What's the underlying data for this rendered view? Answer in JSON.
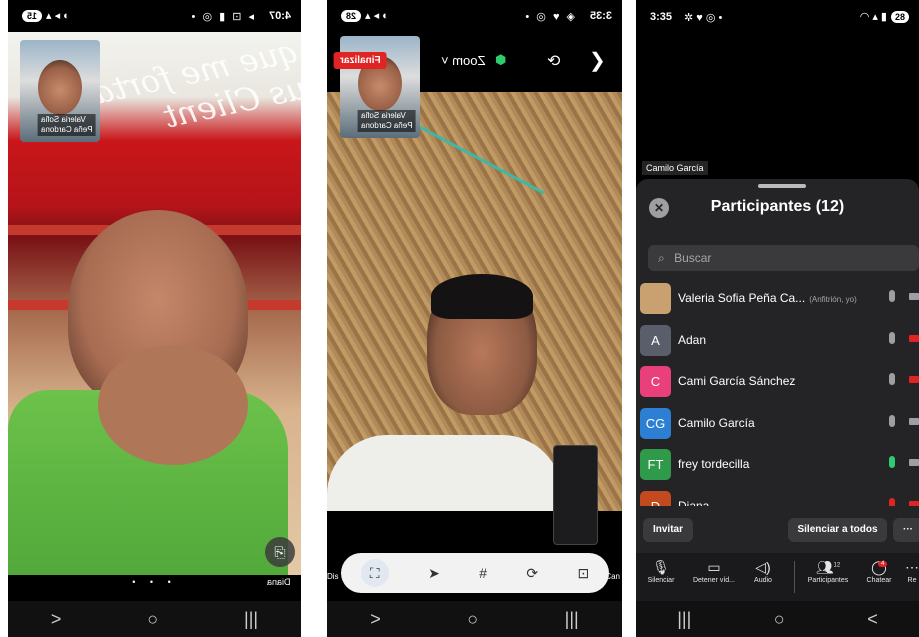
{
  "phone1": {
    "status": {
      "time": "4:07",
      "badge": "15"
    },
    "pip": {
      "name_line1": "Valeria Sofia",
      "name_line2": "Peña Cardona"
    },
    "store_text": "que me fortal us Client",
    "caption_name": "Diana"
  },
  "phone2": {
    "status": {
      "time": "3:35",
      "badge": "28"
    },
    "end_button": "Finalizar",
    "app_title": "Zoom",
    "pip": {
      "name_line1": "Valeria Sofia",
      "name_line2": "Peña Cardona"
    },
    "side_left": "Dis",
    "side_right": "Can"
  },
  "phone3": {
    "status": {
      "time": "3:35",
      "battery": "28"
    },
    "video_name": "Camilo García",
    "sheet_title": "Participantes (12)",
    "search_placeholder": "Buscar",
    "participants": [
      {
        "name": "Valeria Sofia Peña Ca...",
        "tag": "(Anfitrión, yo)",
        "initials": "",
        "color": "#c9a070",
        "mic": "normal",
        "cam": "normal"
      },
      {
        "name": "Adan",
        "tag": "",
        "initials": "A",
        "color": "#5a5e6a",
        "mic": "normal",
        "cam": "off"
      },
      {
        "name": "Cami García Sánchez",
        "tag": "",
        "initials": "C",
        "color": "#e93f7a",
        "mic": "normal",
        "cam": "off"
      },
      {
        "name": "Camilo García",
        "tag": "",
        "initials": "CG",
        "color": "#2d7fd3",
        "mic": "normal",
        "cam": "normal"
      },
      {
        "name": "frey tordecilla",
        "tag": "",
        "initials": "FT",
        "color": "#2f9a4a",
        "mic": "on",
        "cam": "normal"
      },
      {
        "name": "Diana",
        "tag": "",
        "initials": "D",
        "color": "#c24a1e",
        "mic": "muted",
        "cam": "off"
      }
    ],
    "invite_label": "Invitar",
    "mute_all_label": "Silenciar a todos",
    "more_label": "···",
    "toolbar": {
      "mute": "Silenciar",
      "stop_video": "Detener víd...",
      "audio": "Audio",
      "participants": "Participantes",
      "participants_count": "12",
      "chat": "Chatear",
      "chat_badge": "4",
      "more": "Re"
    }
  },
  "nav": {
    "back": "<",
    "home": "○",
    "recents": "|||",
    "back_flipped": ">"
  }
}
